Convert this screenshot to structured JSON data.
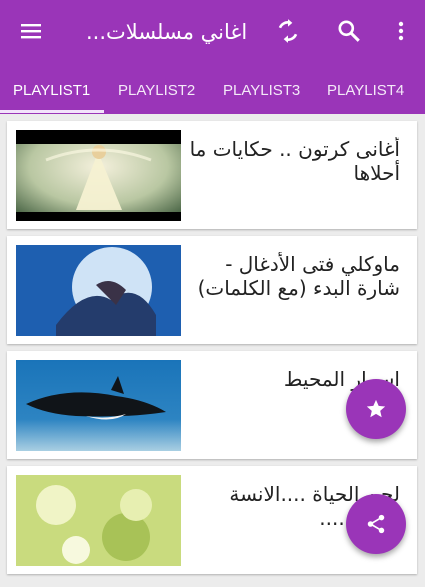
{
  "appbar": {
    "title": "اغاني مسلسلات...",
    "icons": [
      "menu-icon",
      "refresh-icon",
      "search-icon",
      "more-vert-icon"
    ]
  },
  "tabs": [
    {
      "label": "PLAYLIST1",
      "selected": true
    },
    {
      "label": "PLAYLIST2",
      "selected": false
    },
    {
      "label": "PLAYLIST3",
      "selected": false
    },
    {
      "label": "PLAYLIST4",
      "selected": false
    }
  ],
  "videos": [
    {
      "title": "أغانى كرتون .. حكايات ما أحلاها"
    },
    {
      "title": "ماوكلي فتى الأدغال - شارة البدء (مع الكلمات)"
    },
    {
      "title": "اسرار المحيط"
    },
    {
      "title": "لحن الحياة ....الانسة صفاء ....."
    }
  ],
  "fab": {
    "favorite_icon": "star-icon",
    "share_icon": "share-icon"
  },
  "colors": {
    "primary": "#9a35b8",
    "tab_indicator": "#f3e3fb",
    "background": "#ececec"
  }
}
